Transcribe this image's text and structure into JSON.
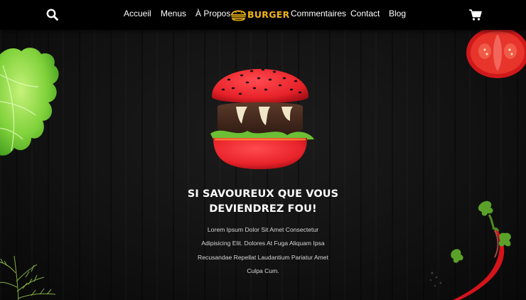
{
  "nav": {
    "links": [
      "Accueil",
      "Menus",
      "À Propos",
      "Commentaires",
      "Contact",
      "Blog"
    ],
    "logo_text": "BURGER",
    "search_icon": "search-icon",
    "cart_icon": "shopping-cart-icon"
  },
  "hero": {
    "title_lines": [
      "SI SAVOUREUX QUE VOUS",
      "DEVIENDREZ FOU!"
    ],
    "text_lines": [
      "Lorem Ipsum Dolor Sit Amet Consectetur",
      "Adipisicing Elit. Dolores At Fuga Aliquam Ipsa",
      "Recusandae Repellat Laudantium Pariatur Amet",
      "Culpa Cum."
    ]
  },
  "colors": {
    "navbar_bg": "#000000",
    "logo_gold": "#f2b51a",
    "bun_red": "#e8232a",
    "page_bg": "#111111"
  }
}
